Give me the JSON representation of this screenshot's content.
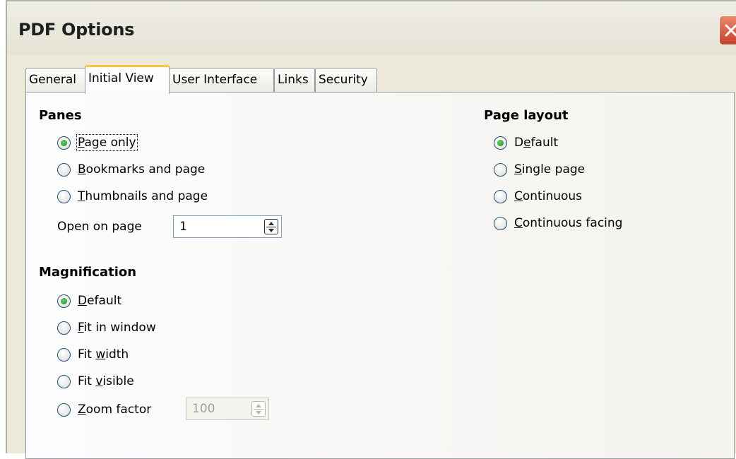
{
  "window": {
    "title": "PDF Options"
  },
  "tabs": [
    {
      "label": "General"
    },
    {
      "label": "Initial View",
      "active": true
    },
    {
      "label": "User Interface"
    },
    {
      "label": "Links"
    },
    {
      "label": "Security"
    }
  ],
  "panes": {
    "heading": "Panes",
    "options": [
      {
        "label": "Page only",
        "mnemonic": "P",
        "rest": "age only",
        "checked": true
      },
      {
        "label": "Bookmarks and page",
        "mnemonic": "B",
        "rest": "ookmarks and page",
        "checked": false
      },
      {
        "label": "Thumbnails and page",
        "mnemonic": "T",
        "rest": "humbnails and page",
        "checked": false
      }
    ],
    "open_on_page_label": "Open on page",
    "open_on_page_value": "1"
  },
  "magnification": {
    "heading": "Magnification",
    "options": [
      {
        "label": "Default",
        "pre": "",
        "mnemonic": "D",
        "rest": "efault",
        "checked": true
      },
      {
        "label": "Fit in window",
        "pre": "",
        "mnemonic": "F",
        "rest": "it in window",
        "checked": false
      },
      {
        "label": "Fit width",
        "pre": "Fit ",
        "mnemonic": "w",
        "rest": "idth",
        "checked": false
      },
      {
        "label": "Fit visible",
        "pre": "Fit ",
        "mnemonic": "v",
        "rest": "isible",
        "checked": false
      },
      {
        "label": "Zoom factor",
        "pre": "",
        "mnemonic": "Z",
        "rest": "oom factor",
        "checked": false
      }
    ],
    "zoom_factor_value": "100"
  },
  "page_layout": {
    "heading": "Page layout",
    "options": [
      {
        "label": "Default",
        "pre": "D",
        "mnemonic": "e",
        "rest": "fault",
        "checked": true
      },
      {
        "label": "Single page",
        "pre": "",
        "mnemonic": "S",
        "rest": "ingle page",
        "checked": false
      },
      {
        "label": "Continuous",
        "pre": "",
        "mnemonic": "C",
        "rest": "ontinuous",
        "checked": false
      },
      {
        "label": "Continuous facing",
        "pre": "",
        "mnemonic": "C",
        "rest": "ontinuous facing",
        "checked": false
      }
    ]
  },
  "icons": {
    "close": "close-icon",
    "radio_checked_color": "#1b8a1b",
    "tab_active_accent": "#ffc83c",
    "close_button_color": "#c7422a"
  }
}
